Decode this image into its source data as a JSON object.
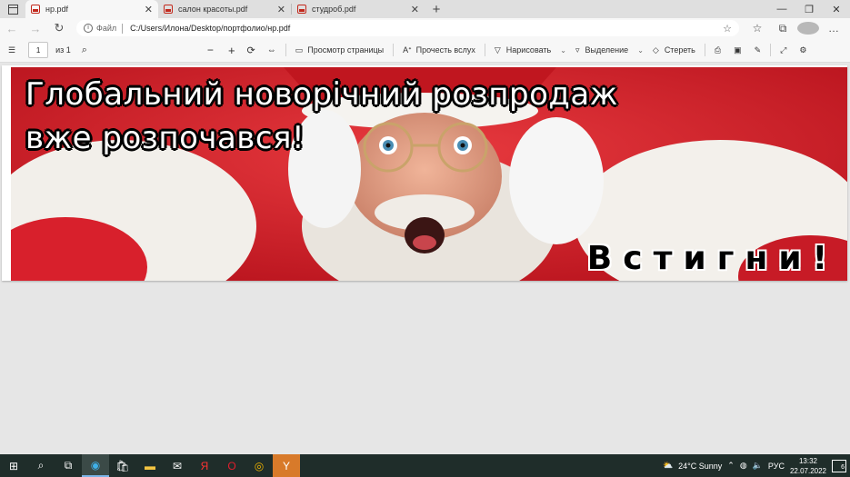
{
  "tabs": [
    {
      "title": "нр.pdf",
      "active": true
    },
    {
      "title": "салон красоты.pdf",
      "active": false
    },
    {
      "title": "студроб.pdf",
      "active": false
    }
  ],
  "addressbar": {
    "label": "Файл",
    "url": "C:/Users/Илона/Desktop/портфолио/нр.pdf"
  },
  "pdf_toolbar": {
    "page_number": "1",
    "page_of": "из 1",
    "page_view": "Просмотр страницы",
    "read_aloud": "Прочесть вслух",
    "draw": "Нарисовать",
    "highlight": "Выделение",
    "erase": "Стереть"
  },
  "document": {
    "headline_line1": "Глобальний  новорічний  розпродаж",
    "headline_line2": "вже розпочався!",
    "cta": "Встигни!",
    "background_color": "#d8202c"
  },
  "taskbar": {
    "weather": "24°C  Sunny",
    "language": "РУС",
    "time": "13:32",
    "date": "22.07.2022",
    "notifications": "6"
  }
}
